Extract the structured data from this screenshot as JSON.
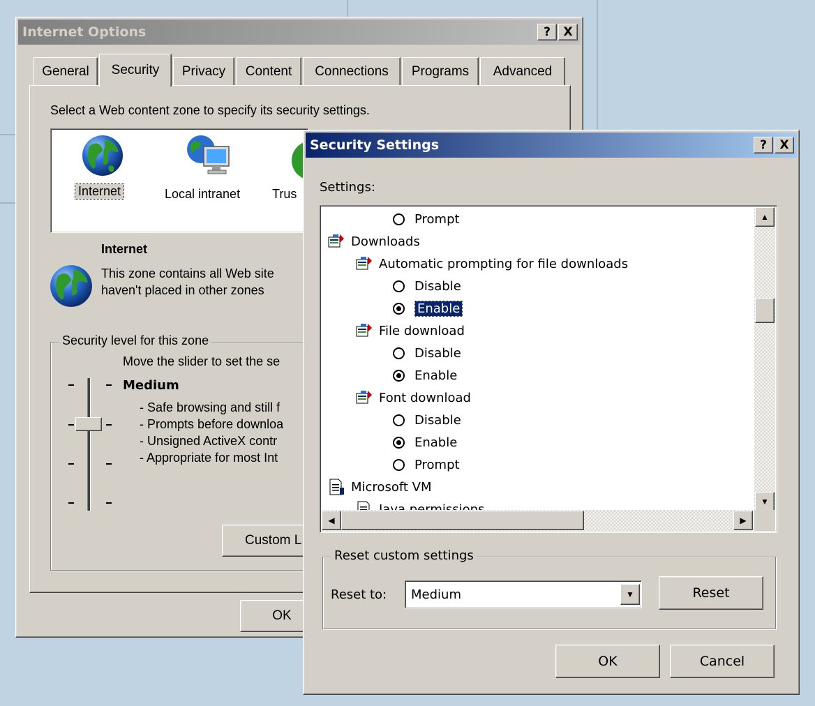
{
  "colors": {
    "desktop": "#c0d3e3",
    "face": "#d4d0c8",
    "active_title": "#0a246a",
    "selection": "#0a246a"
  },
  "internet_options": {
    "title": "Internet Options",
    "help_button": "?",
    "close_button": "X",
    "tabs": [
      "General",
      "Security",
      "Privacy",
      "Content",
      "Connections",
      "Programs",
      "Advanced"
    ],
    "selected_tab": "Security",
    "zone_prompt": "Select a Web content zone to specify its security settings.",
    "zones": [
      {
        "label": "Internet",
        "icon": "globe-icon"
      },
      {
        "label": "Local intranet",
        "icon": "intranet-icon"
      },
      {
        "label": "Trus",
        "icon": "trusted-sites-icon"
      }
    ],
    "zone_title": "Internet",
    "zone_desc_1": "This zone contains all Web site",
    "zone_desc_2": "haven't placed in other zones",
    "security_level_label": "Security level for this zone",
    "slider_hint": "Move the slider to set the se",
    "level_name": "Medium",
    "level_points": [
      "- Safe browsing and still f",
      "- Prompts before downloa",
      "- Unsigned ActiveX contr",
      "- Appropriate for most Int"
    ],
    "custom_level_button": "Custom L",
    "ok_button": "OK"
  },
  "security_settings": {
    "title": "Security Settings",
    "help_button": "?",
    "close_button": "X",
    "settings_label": "Settings:",
    "items": [
      {
        "kind": "radio",
        "indent": 1,
        "label": "Prompt",
        "checked": false
      },
      {
        "kind": "category",
        "indent": 0,
        "label": "Downloads",
        "icon": "settings-category-icon"
      },
      {
        "kind": "setting",
        "indent": 1,
        "label": "Automatic prompting for file downloads",
        "icon": "settings-category-icon"
      },
      {
        "kind": "radio",
        "indent": 1,
        "label": "Disable",
        "checked": false
      },
      {
        "kind": "radio",
        "indent": 1,
        "label": "Enable",
        "checked": true,
        "selected": true
      },
      {
        "kind": "setting",
        "indent": 1,
        "label": "File download",
        "icon": "settings-category-icon"
      },
      {
        "kind": "radio",
        "indent": 1,
        "label": "Disable",
        "checked": false
      },
      {
        "kind": "radio",
        "indent": 1,
        "label": "Enable",
        "checked": true
      },
      {
        "kind": "setting",
        "indent": 1,
        "label": "Font download",
        "icon": "settings-category-icon"
      },
      {
        "kind": "radio",
        "indent": 1,
        "label": "Disable",
        "checked": false
      },
      {
        "kind": "radio",
        "indent": 1,
        "label": "Enable",
        "checked": true
      },
      {
        "kind": "radio",
        "indent": 1,
        "label": "Prompt",
        "checked": false
      },
      {
        "kind": "category",
        "indent": 0,
        "label": "Microsoft VM",
        "icon": "document-icon"
      },
      {
        "kind": "setting",
        "indent": 1,
        "label": "Java permissions",
        "icon": "document-icon"
      }
    ],
    "reset_group_label": "Reset custom settings",
    "reset_to_label": "Reset to:",
    "reset_to_value": "Medium",
    "reset_button": "Reset",
    "ok_button": "OK",
    "cancel_button": "Cancel"
  }
}
